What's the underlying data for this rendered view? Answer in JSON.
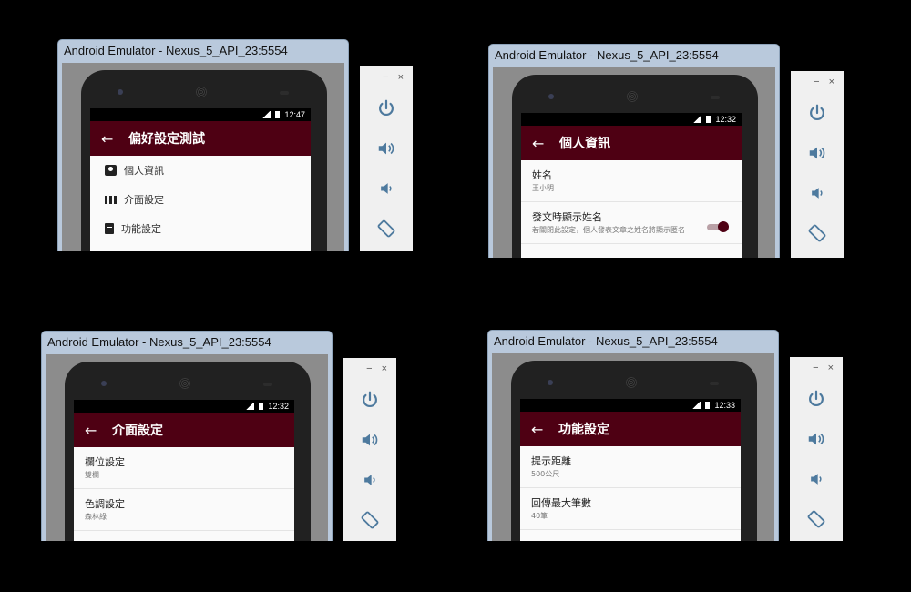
{
  "emulators": [
    {
      "window_title": "Android Emulator - Nexus_5_API_23:5554",
      "status_time": "12:47",
      "screen_title": "偏好設定測試",
      "menu_items": [
        {
          "icon": "person-badge-icon",
          "label": "個人資訊"
        },
        {
          "icon": "view-column-icon",
          "label": "介面設定"
        },
        {
          "icon": "clipboard-icon",
          "label": "功能設定"
        }
      ]
    },
    {
      "window_title": "Android Emulator - Nexus_5_API_23:5554",
      "status_time": "12:32",
      "screen_title": "個人資訊",
      "prefs": [
        {
          "title": "姓名",
          "summary": "王小明"
        },
        {
          "title": "發文時顯示姓名",
          "summary": "若關閉此設定，個人發表文章之姓名將顯示匿名",
          "switch_on": true
        }
      ]
    },
    {
      "window_title": "Android Emulator - Nexus_5_API_23:5554",
      "status_time": "12:32",
      "screen_title": "介面設定",
      "prefs": [
        {
          "title": "欄位設定",
          "summary": "雙欄"
        },
        {
          "title": "色調設定",
          "summary": "森林綠"
        }
      ]
    },
    {
      "window_title": "Android Emulator - Nexus_5_API_23:5554",
      "status_time": "12:33",
      "screen_title": "功能設定",
      "prefs": [
        {
          "title": "提示距離",
          "summary": "500公尺"
        },
        {
          "title": "回傳最大筆數",
          "summary": "40筆"
        }
      ]
    }
  ],
  "toolbar": {
    "minimize_label": "−",
    "close_label": "×",
    "buttons": [
      "power-icon",
      "volume-up-icon",
      "volume-down-icon",
      "rotate-icon"
    ]
  },
  "colors": {
    "app_bar": "#4e0013",
    "toggle_on": "#4e0013",
    "toolbar_icon": "#4e7a9e"
  }
}
